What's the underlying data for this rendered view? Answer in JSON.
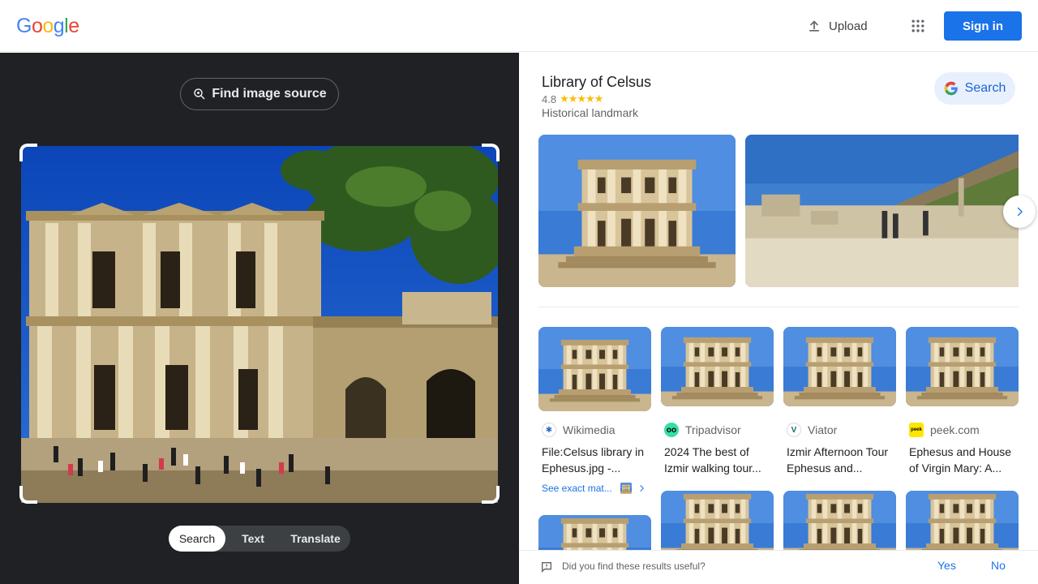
{
  "header": {
    "logo_letters": [
      {
        "ch": "G",
        "color": "#4285f4"
      },
      {
        "ch": "o",
        "color": "#ea4335"
      },
      {
        "ch": "o",
        "color": "#fbbc05"
      },
      {
        "ch": "g",
        "color": "#4285f4"
      },
      {
        "ch": "l",
        "color": "#34a853"
      },
      {
        "ch": "e",
        "color": "#ea4335"
      }
    ],
    "upload_label": "Upload",
    "signin_label": "Sign in"
  },
  "left": {
    "find_source_label": "Find image source",
    "tabs": [
      {
        "label": "Search",
        "active": true
      },
      {
        "label": "Text",
        "active": false
      },
      {
        "label": "Translate",
        "active": false
      }
    ]
  },
  "knowledge_panel": {
    "title": "Library of Celsus",
    "rating": "4.8",
    "stars": "★★★★★",
    "subtitle": "Historical landmark",
    "search_label": "Search"
  },
  "results": [
    {
      "source": "Wikimedia",
      "title": "File:Celsus library in Ephesus.jpg -...",
      "fav_bg": "#ffffff",
      "fav_fg": "#3366cc",
      "fav_text": "✱"
    },
    {
      "source": "Tripadvisor",
      "title": "2024 The best of Izmir walking tour...",
      "fav_bg": "#34e0a1",
      "fav_fg": "#000000",
      "fav_text": "oo"
    },
    {
      "source": "Viator",
      "title": "Izmir Afternoon Tour Ephesus and...",
      "fav_bg": "#ffffff",
      "fav_fg": "#186b6d",
      "fav_text": "V"
    },
    {
      "source": "peek.com",
      "title": "Ephesus and House of Virgin Mary: A...",
      "fav_bg": "#ffe600",
      "fav_fg": "#000000",
      "fav_text": "peek"
    }
  ],
  "see_exact_label": "See exact mat...",
  "feedback": {
    "question": "Did you find these results useful?",
    "yes": "Yes",
    "no": "No"
  },
  "colors": {
    "accent": "#1a73e8",
    "dark_panel": "#202124"
  }
}
